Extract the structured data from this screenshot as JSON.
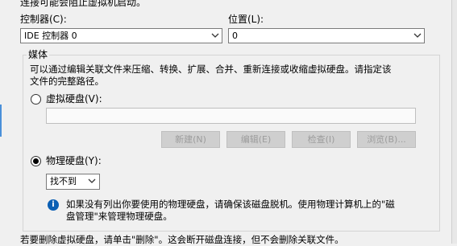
{
  "top_text": "连接可能会阻止虚拟机启动。",
  "controller": {
    "label": "控制器(C):",
    "value": "IDE 控制器 0"
  },
  "location": {
    "label": "位置(L):",
    "value": "0"
  },
  "media": {
    "group_label": "媒体",
    "description_line1": "可以通过编辑关联文件来压缩、转换、扩展、合并、重新连接或收缩虚拟硬盘。请指定该",
    "description_line2": "文件的完整路径。",
    "virtual_disk_label": "虚拟硬盘(V):",
    "virtual_disk_path": "",
    "buttons": {
      "new": "新建(N)",
      "edit": "编辑(E)",
      "inspect": "检查(I)",
      "browse": "浏览(B)..."
    },
    "physical_disk_label": "物理硬盘(Y):",
    "physical_disk_value": "找不到",
    "info_line1": "如果没有列出你要使用的物理硬盘，请确保该磁盘脱机。使用物理计算机上的\"磁",
    "info_line2": "盘管理\"来管理物理硬盘。",
    "selected": "physical"
  },
  "bottom_text": "若要删除虚拟硬盘，请单击\"删除\"。这会断开磁盘连接，但不会删除关联文件。"
}
